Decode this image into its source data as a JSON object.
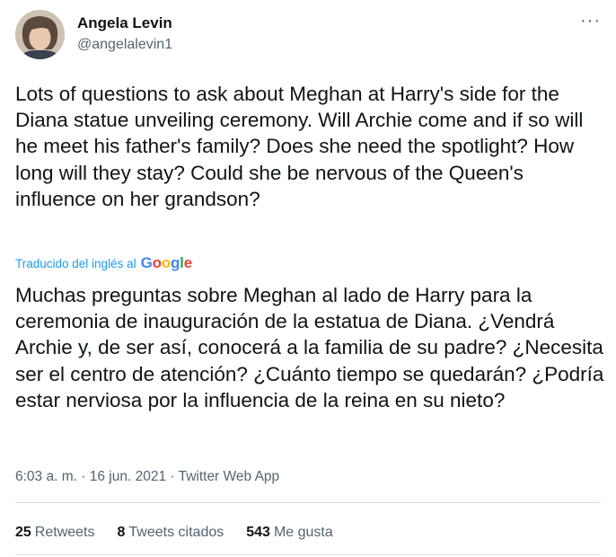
{
  "author": {
    "name": "Angela Levin",
    "handle": "@angelalevin1"
  },
  "more_icon": "more-horizontal-icon",
  "tweet": {
    "text": "Lots of questions to ask about Meghan at Harry's side for the Diana statue unveiling ceremony.   Will Archie come and if so will he meet his father's family?  Does she need the spotlight?  How long will they stay? Could she be nervous of the Queen's influence on her grandson?",
    "translated_note": "Traducido del inglés al",
    "translator": "Google",
    "translation": "Muchas preguntas sobre Meghan al lado de Harry para la ceremonia de inauguración de la estatua de Diana. ¿Vendrá Archie y, de ser así, conocerá a la familia de su padre? ¿Necesita ser el centro de atención? ¿Cuánto tiempo se quedarán? ¿Podría estar nerviosa por la influencia de la reina en su nieto?",
    "time": "6:03 a. m.",
    "date": "16 jun. 2021",
    "separator": "·",
    "source": "Twitter Web App"
  },
  "stats": {
    "retweets_count": "25",
    "retweets_label": "Retweets",
    "quotes_count": "8",
    "quotes_label": "Tweets citados",
    "likes_count": "543",
    "likes_label": "Me gusta"
  },
  "colors": {
    "link": "#1d9bf0",
    "secondary": "#536471",
    "text": "#0f1419",
    "google_blue": "#4285F4",
    "google_red": "#EA4335",
    "google_yellow": "#FBBC05",
    "google_green": "#34A853"
  }
}
